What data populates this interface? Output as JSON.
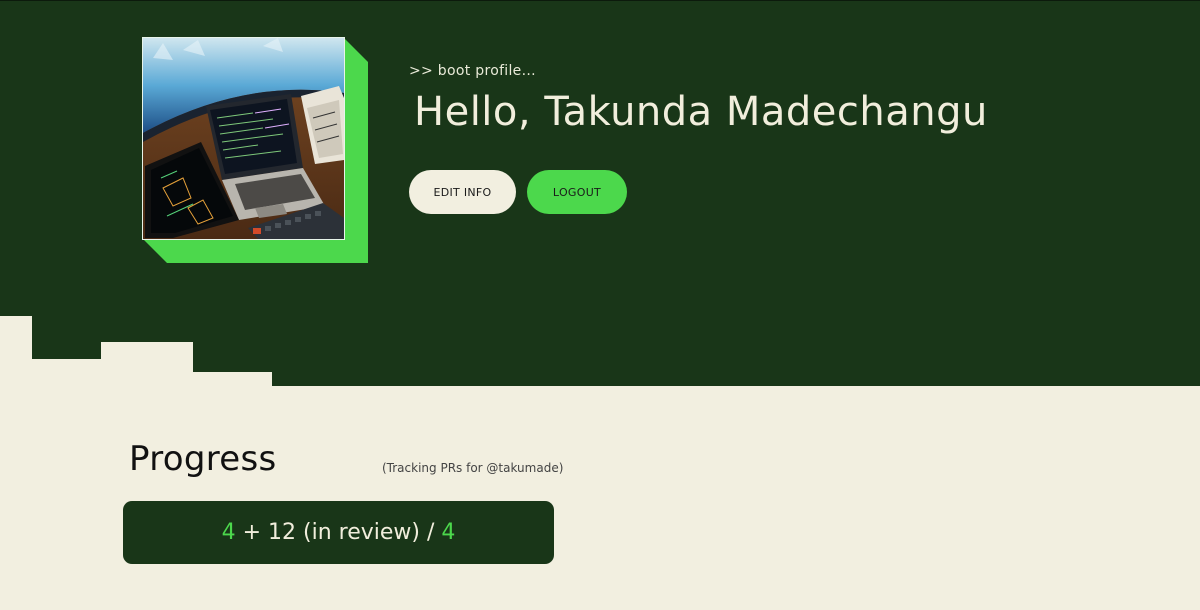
{
  "profile": {
    "boot_line": ">> boot profile...",
    "greeting": "Hello, Takunda Madechangu",
    "edit_label": "EDIT INFO",
    "logout_label": "LOGOUT"
  },
  "progress": {
    "title": "Progress",
    "tracking_note": "(Tracking PRs for @takumade)",
    "merged": "4",
    "plus": " + ",
    "in_review": "12 (in review)",
    "slash": " / ",
    "goal": "4"
  },
  "colors": {
    "dark_green": "#193618",
    "accent_green": "#4cd84c",
    "cream": "#f2efe0"
  }
}
